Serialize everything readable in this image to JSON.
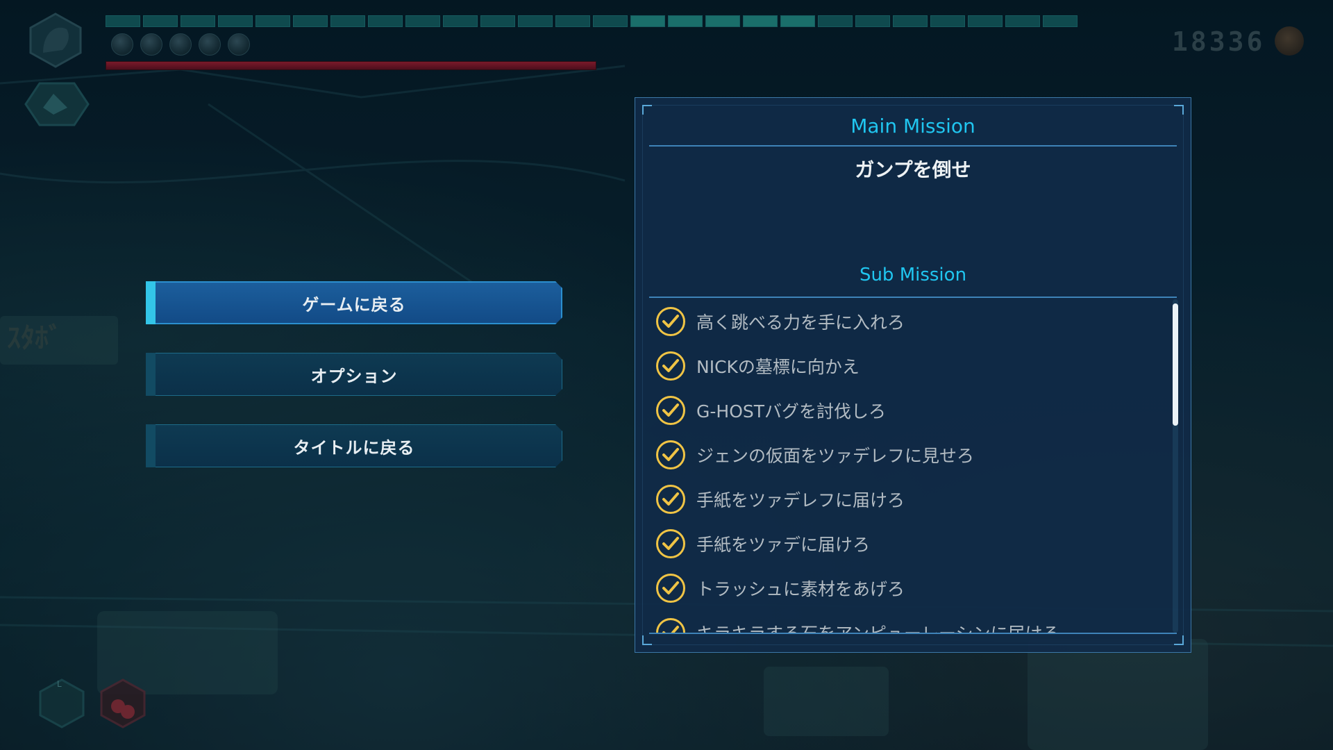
{
  "hud": {
    "score": "18336",
    "stamina_segments": 26,
    "stamina_lit": [
      14,
      15,
      16,
      17,
      18
    ],
    "orbs": 5,
    "hp_fraction": 0.82,
    "colors": {
      "hp": "#7a1a2a",
      "stamina": "#0f4a4e",
      "accent": "#20c6f0"
    }
  },
  "menu": {
    "items": [
      {
        "label": "ゲームに戻る",
        "selected": true
      },
      {
        "label": "オプション",
        "selected": false
      },
      {
        "label": "タイトルに戻る",
        "selected": false
      }
    ]
  },
  "mission": {
    "main_header": "Main Mission",
    "main_text": "ガンプを倒せ",
    "sub_header": "Sub Mission",
    "sub_items": [
      {
        "text": "高く跳べる力を手に入れろ",
        "done": true
      },
      {
        "text": "NICKの墓標に向かえ",
        "done": true
      },
      {
        "text": "G-HOSTバグを討伐しろ",
        "done": true
      },
      {
        "text": "ジェンの仮面をツァデレフに見せろ",
        "done": true
      },
      {
        "text": "手紙をツァデレフに届けろ",
        "done": true
      },
      {
        "text": "手紙をツァデに届けろ",
        "done": true
      },
      {
        "text": "トラッシュに素材をあげろ",
        "done": true
      },
      {
        "text": "キラキラする石をアンピューレーシンに届けろ",
        "done": true
      }
    ],
    "scroll_fraction": 0.35
  }
}
